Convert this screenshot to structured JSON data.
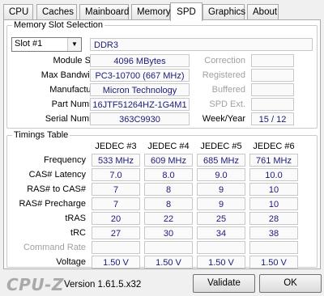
{
  "tabs": [
    "CPU",
    "Caches",
    "Mainboard",
    "Memory",
    "SPD",
    "Graphics",
    "About"
  ],
  "active_tab": "SPD",
  "memory_slot": {
    "title": "Memory Slot Selection",
    "slot_value": "Slot #1",
    "type": "DDR3",
    "labels": {
      "module_size": "Module Size",
      "max_bandwidth": "Max Bandwidth",
      "manufacturer": "Manufacturer",
      "part_number": "Part Number",
      "serial_number": "Serial Number",
      "correction": "Correction",
      "registered": "Registered",
      "buffered": "Buffered",
      "spd_ext": "SPD Ext.",
      "week_year": "Week/Year"
    },
    "values": {
      "module_size": "4096 MBytes",
      "max_bandwidth": "PC3-10700 (667 MHz)",
      "manufacturer": "Micron Technology",
      "part_number": "16JTF51264HZ-1G4M1",
      "serial_number": "363C9930",
      "correction": "",
      "registered": "",
      "buffered": "",
      "spd_ext": "",
      "week_year": "15 / 12"
    }
  },
  "timings": {
    "title": "Timings Table",
    "columns": [
      "JEDEC #3",
      "JEDEC #4",
      "JEDEC #5",
      "JEDEC #6"
    ],
    "rows": [
      {
        "label": "Frequency",
        "dim": false,
        "values": [
          "533 MHz",
          "609 MHz",
          "685 MHz",
          "761 MHz"
        ]
      },
      {
        "label": "CAS# Latency",
        "dim": false,
        "values": [
          "7.0",
          "8.0",
          "9.0",
          "10.0"
        ]
      },
      {
        "label": "RAS# to CAS#",
        "dim": false,
        "values": [
          "7",
          "8",
          "9",
          "10"
        ]
      },
      {
        "label": "RAS# Precharge",
        "dim": false,
        "values": [
          "7",
          "8",
          "9",
          "10"
        ]
      },
      {
        "label": "tRAS",
        "dim": false,
        "values": [
          "20",
          "22",
          "25",
          "28"
        ]
      },
      {
        "label": "tRC",
        "dim": false,
        "values": [
          "27",
          "30",
          "34",
          "38"
        ]
      },
      {
        "label": "Command Rate",
        "dim": true,
        "values": [
          "",
          "",
          "",
          ""
        ]
      },
      {
        "label": "Voltage",
        "dim": false,
        "values": [
          "1.50 V",
          "1.50 V",
          "1.50 V",
          "1.50 V"
        ]
      }
    ]
  },
  "footer": {
    "logo": "CPU-Z",
    "version": "Version 1.61.5.x32",
    "validate": "Validate",
    "ok": "OK"
  },
  "colors": {
    "value_text": "#1b1b7a",
    "dim_label": "#a0a0a0",
    "logo": "#a9a9a9"
  }
}
